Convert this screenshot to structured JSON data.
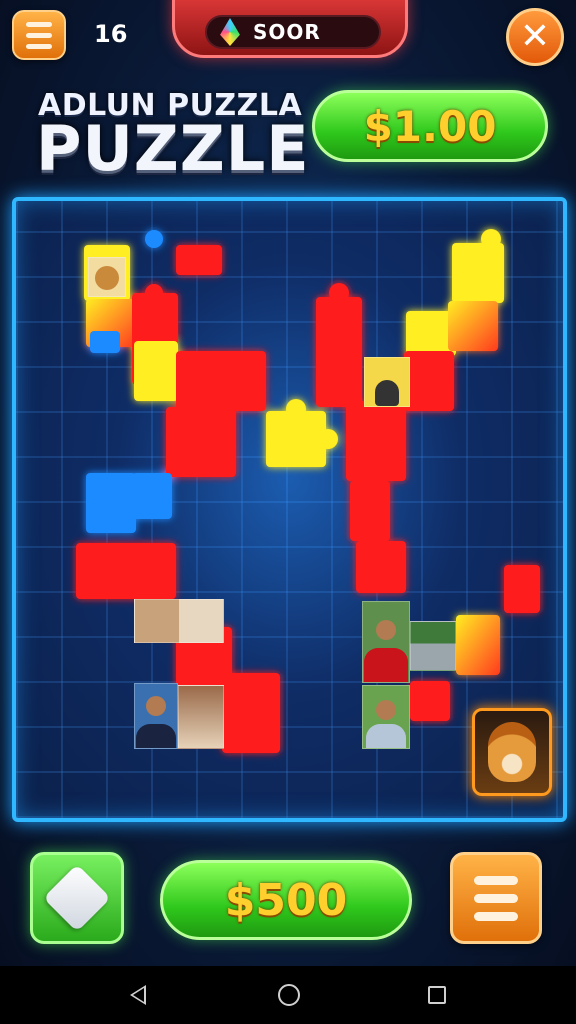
{
  "header": {
    "level": "16",
    "score_label": "SOOR",
    "title_small": "ADLUN PUZZLA",
    "title_big": "PUZZLE",
    "price": "$1.00"
  },
  "footer": {
    "coins": "$500"
  },
  "colors": {
    "red": "#ff1f1f",
    "yellow": "#ffee22",
    "blue": "#1f8bff",
    "green_button": "#2fc81c",
    "orange_button": "#e0700a",
    "board_border": "#2fb8ff"
  },
  "icons": [
    "menu-icon",
    "gem-icon",
    "close-icon",
    "diamond-icon",
    "list-icon",
    "back-icon",
    "home-icon",
    "recent-apps-icon"
  ]
}
